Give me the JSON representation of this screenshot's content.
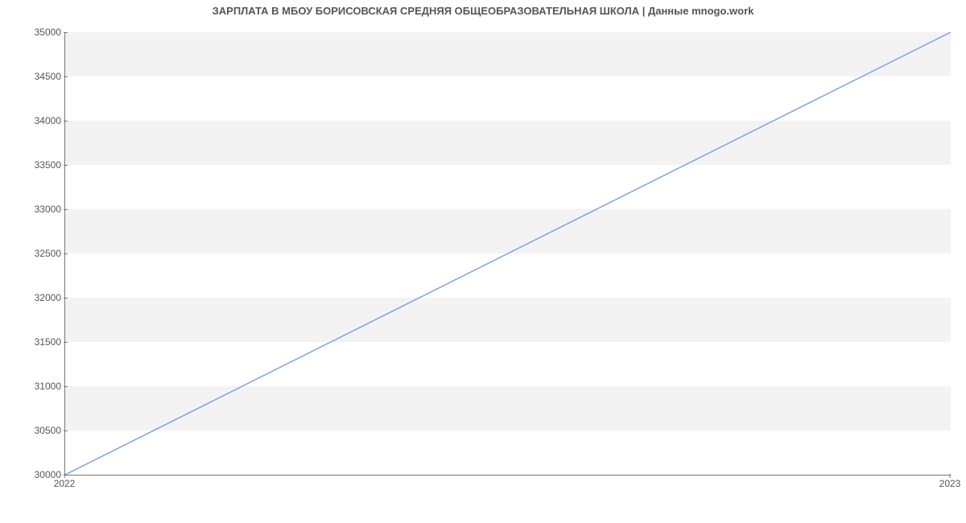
{
  "chart_data": {
    "type": "line",
    "title": "ЗАРПЛАТА В МБОУ БОРИСОВСКАЯ СРЕДНЯЯ ОБЩЕОБРАЗОВАТЕЛЬНАЯ ШКОЛА | Данные mnogo.work",
    "x_categories": [
      "2022",
      "2023"
    ],
    "y_ticks": [
      30000,
      30500,
      31000,
      31500,
      32000,
      32500,
      33000,
      33500,
      34000,
      34500,
      35000
    ],
    "ylim": [
      30000,
      35000
    ],
    "series": [
      {
        "name": "salary",
        "color": "#6e9be6",
        "values": [
          30000,
          35000
        ]
      }
    ],
    "xlabel": "",
    "ylabel": ""
  }
}
